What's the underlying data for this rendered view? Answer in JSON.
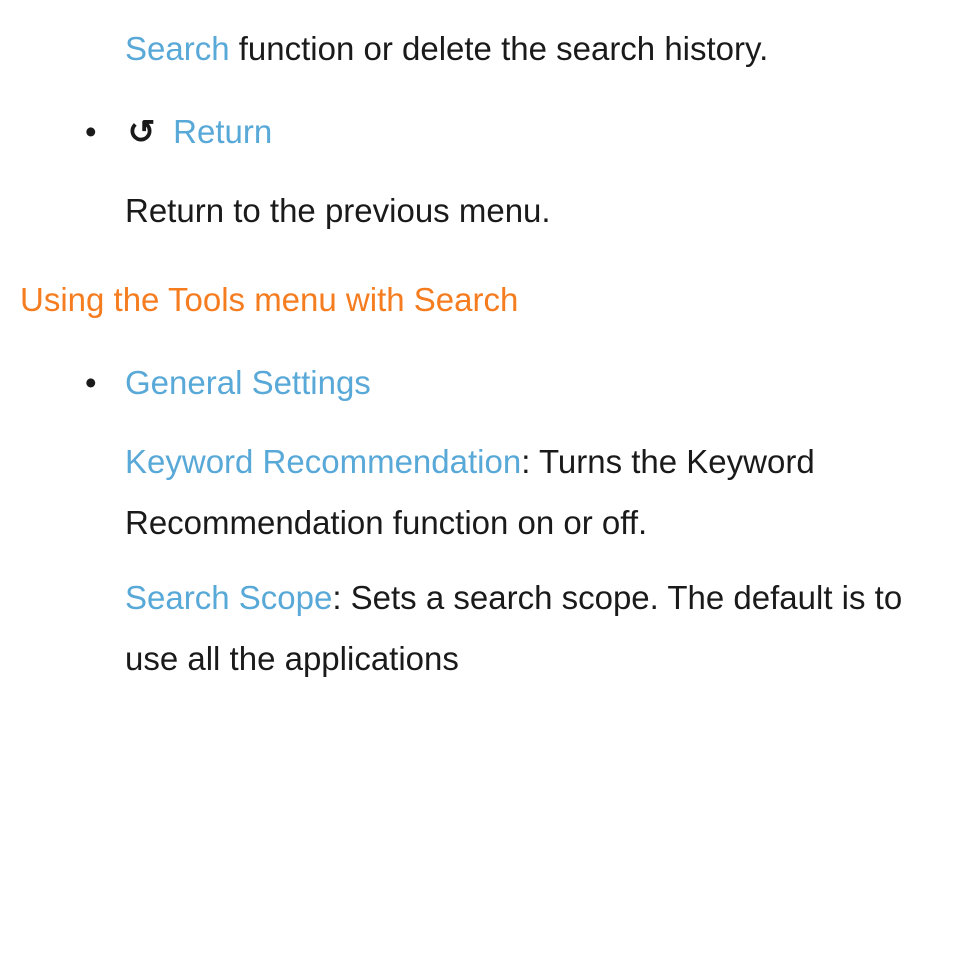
{
  "top_fragment": {
    "link": "Search",
    "rest": " function or delete the search history."
  },
  "return_item": {
    "icon": "↺",
    "label": "Return",
    "body": "Return to the previous menu."
  },
  "section_heading": "Using the Tools menu with Search",
  "general_item": {
    "label": "General Settings",
    "keyword": {
      "label": "Keyword Recommendation",
      "rest": ": Turns the Keyword Recommendation function on or off."
    },
    "scope": {
      "label": "Search Scope",
      "rest": ": Sets a search scope. The default is to use all the applications"
    }
  }
}
